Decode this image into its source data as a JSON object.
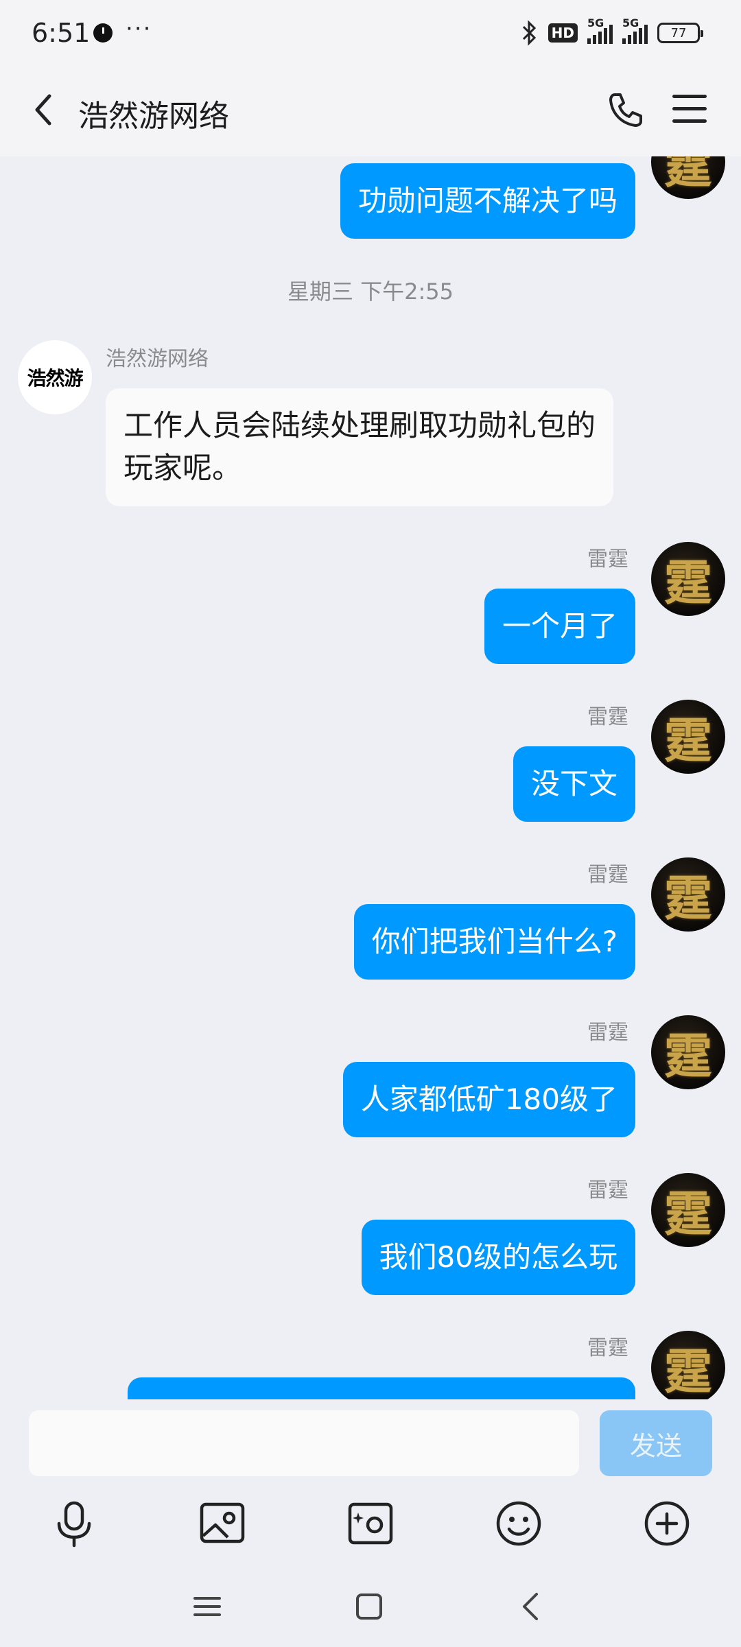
{
  "status_bar": {
    "time": "6:51",
    "dots": "···",
    "hd": "HD",
    "signal1": "5G",
    "signal2": "5G",
    "battery": "77"
  },
  "header": {
    "title": "浩然游网络"
  },
  "chat": {
    "msg_top": "功勋问题不解决了吗",
    "timestamp": "星期三 下午2:55",
    "bot_name": "浩然游网络",
    "bot_avatar_text": "浩然游",
    "bot_message": "工作人员会陆续处理刷取功勋礼包的玩家呢。",
    "user_name": "雷霆",
    "user_avatar_glyph": "霆",
    "messages": [
      "一个月了",
      "没下文",
      "你们把我们当什么?",
      "人家都低矿180级了",
      "我们80级的怎么玩"
    ]
  },
  "input": {
    "placeholder": "",
    "send_label": "发送"
  },
  "colors": {
    "bubble_out": "#0099ff",
    "send_disabled": "#89c6f5",
    "background": "#eeeff4"
  },
  "icons": [
    "back-icon",
    "phone-icon",
    "menu-icon",
    "mic-icon",
    "image-icon",
    "camera-icon",
    "emoji-icon",
    "plus-icon"
  ]
}
